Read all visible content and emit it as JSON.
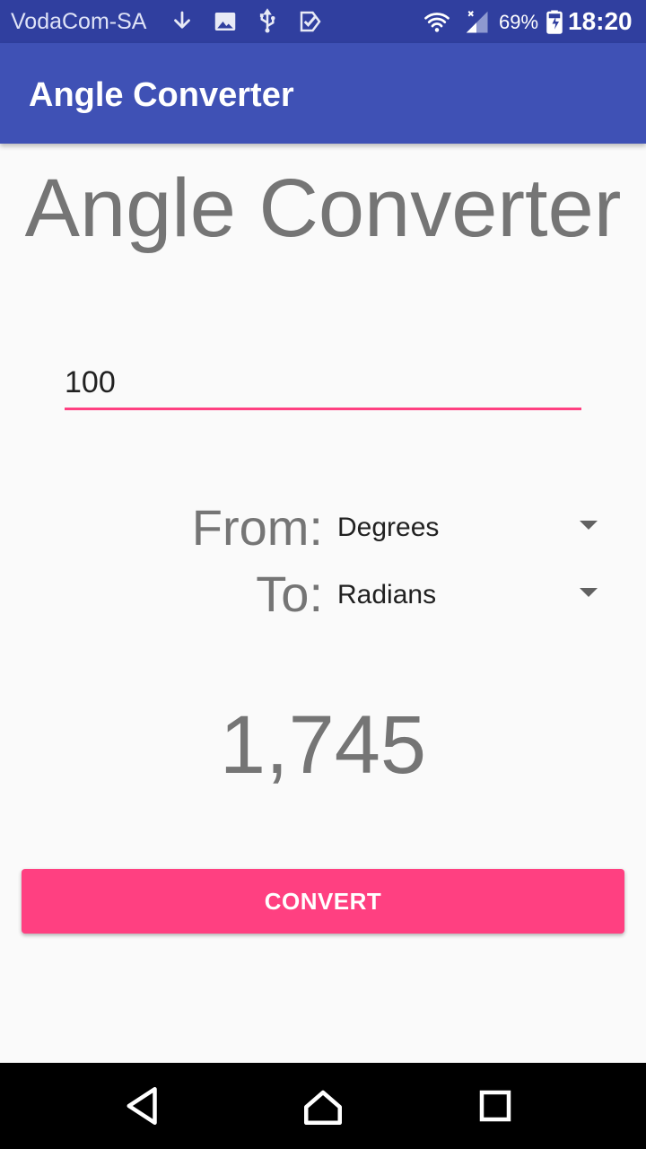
{
  "status_bar": {
    "carrier": "VodaCom-SA",
    "battery_percent": "69%",
    "time": "18:20",
    "icons": [
      "download-icon",
      "image-icon",
      "usb-icon",
      "checkbox-app-icon",
      "wifi-icon",
      "signal-icon",
      "battery-icon"
    ]
  },
  "app_bar": {
    "title": "Angle Converter"
  },
  "main": {
    "heading": "Angle Converter",
    "input_value": "100",
    "from_label": "From:",
    "from_value": "Degrees",
    "to_label": "To:",
    "to_value": "Radians",
    "result": "1,745",
    "convert_label": "CONVERT"
  },
  "nav_bar": {
    "icons": [
      "back-icon",
      "home-icon",
      "recents-icon"
    ]
  },
  "colors": {
    "status_bar": "#303f9f",
    "app_bar": "#3f51b5",
    "accent": "#ff4081",
    "text_gray": "#757575",
    "background": "#fafafa"
  }
}
